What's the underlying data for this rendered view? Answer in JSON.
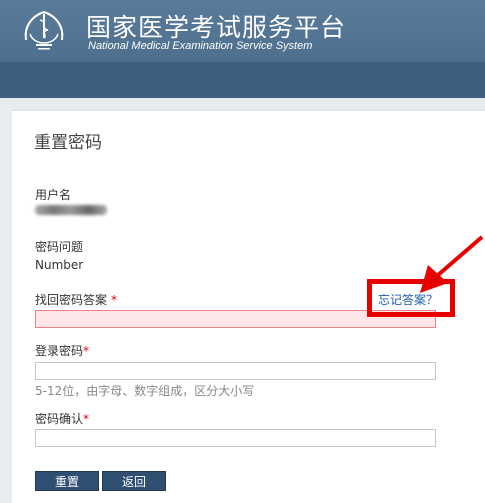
{
  "header": {
    "title_cn": "国家医学考试服务平台",
    "title_en": "National Medical Examination Service System",
    "bg_color": "#4f6f8f"
  },
  "card": {
    "title": "重置密码"
  },
  "username": {
    "label": "用户名",
    "value_blurred": true
  },
  "security_question": {
    "label": "密码问题",
    "value": "Number"
  },
  "answer": {
    "label": "找回密码答案",
    "required_mark": "*",
    "forgot_link": "忘记答案？",
    "value": ""
  },
  "password": {
    "label": "登录密码",
    "required_mark": "*",
    "value": "",
    "hint": "5-12位，由字母、数字组成，区分大小写"
  },
  "confirm": {
    "label": "密码确认",
    "required_mark": "*",
    "value": ""
  },
  "buttons": {
    "reset": "重置",
    "back": "返回"
  },
  "colors": {
    "accent_red": "#e60012",
    "link": "#1f5fa8",
    "button": "#2f4f73"
  }
}
